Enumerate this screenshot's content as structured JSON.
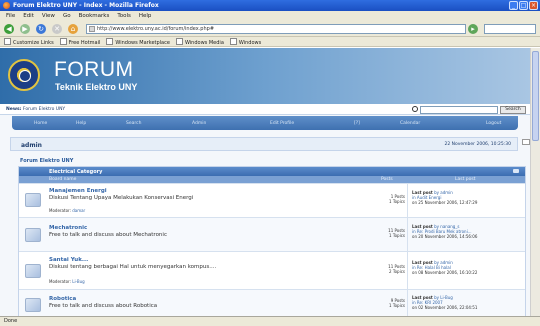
{
  "window": {
    "title": "Forum Elektro UNY - Index - Mozilla Firefox"
  },
  "menubar": [
    "File",
    "Edit",
    "View",
    "Go",
    "Bookmarks",
    "Tools",
    "Help"
  ],
  "address": {
    "url": "http://www.elektro.uny.ac.id/forum/index.php#"
  },
  "bookmarks": [
    "Customize Links",
    "Free Hotmail",
    "Windows Marketplace",
    "Windows Media",
    "Windows"
  ],
  "header": {
    "title": "FORUM",
    "subtitle": "Teknik Elektro UNY"
  },
  "news": {
    "label": "News:",
    "text": "Forum Elektro UNY"
  },
  "search": {
    "button": "Search"
  },
  "nav_menu": [
    "Home",
    "Help",
    "Search",
    "Admin",
    "Edit Profile",
    "[?]",
    "Calendar",
    "Logout"
  ],
  "welcome": {
    "user": "admin",
    "datetime": "22 November 2006, 10:25:30"
  },
  "breadcrumb": "Forum Elektro UNY",
  "category": {
    "title": "Electrical Category",
    "col_board": "Board name",
    "col_posts": "Posts",
    "col_last": "Last post"
  },
  "boards": [
    {
      "name": "Manajemen Energi",
      "desc": "Diskusi Tentang Upaya Melakukan Konservasi Energi",
      "moderator_label": "Moderator:",
      "moderator": "damar",
      "posts": "1 Posts",
      "topics": "1 Topics",
      "last_label": "Last post",
      "last_by": "by admin",
      "last_in": "in Audit Energi",
      "last_on": "on 25 November 2006, 12:47:29"
    },
    {
      "name": "Mechatronic",
      "desc": "Free to talk and discuss about Mechatronic",
      "moderator_label": "",
      "moderator": "",
      "posts": "11 Posts",
      "topics": "1 Topics",
      "last_label": "Last post",
      "last_by": "by nanang_s",
      "last_in": "in Re: Prodi Baru Mek atroni...",
      "last_on": "on 20 November 2006, 14:56:06"
    },
    {
      "name": "Santai Yuk...",
      "desc": "Diskusi tentang berbagai Hal untuk menyegarkan kompus....",
      "moderator_label": "Moderator:",
      "moderator": "Li-Bug",
      "posts": "11 Posts",
      "topics": "2 Topics",
      "last_label": "Last post",
      "last_by": "by admin",
      "last_in": "in Re: Halal Bi halal",
      "last_on": "on 08 November 2006, 16:10:22"
    },
    {
      "name": "Robotica",
      "desc": "Free to talk and discuss about Robotica",
      "moderator_label": "",
      "moderator": "",
      "posts": "9 Posts",
      "topics": "1 Topics",
      "last_label": "Last post",
      "last_by": "by Li-Bug",
      "last_in": "in Re: KRI 2007",
      "last_on": "on 02 November 2006, 22:04:51"
    }
  ],
  "status": "Done"
}
